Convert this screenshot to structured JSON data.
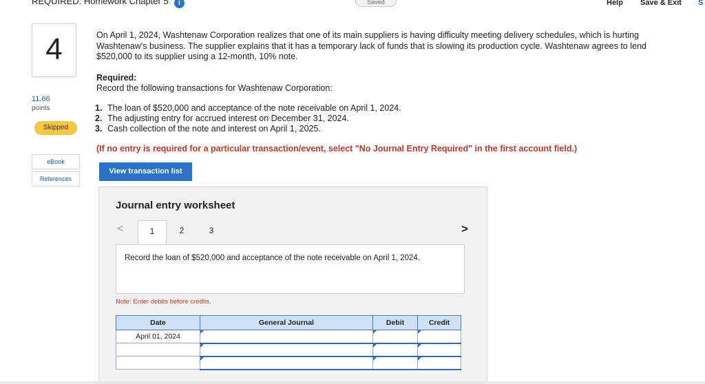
{
  "header": {
    "assignment_title": "REQUIRED: Homework Chapter 5",
    "info_badge": "i",
    "saved_status": "Saved",
    "help": "Help",
    "save_exit": "Save & Exit",
    "submit_partial": "S"
  },
  "sidebar": {
    "question_number": "4",
    "points_value": "11.66",
    "points_label": "points",
    "status_badge": "Skipped",
    "ebook": "eBook",
    "references": "References"
  },
  "question": {
    "paragraph": "On April 1, 2024, Washtenaw Corporation realizes that one of its main suppliers is having difficulty meeting delivery schedules, which is hurting Washtenaw's business. The supplier explains that it has a temporary lack of funds that is slowing its production cycle. Washtenaw agrees to lend $520,000 to its supplier using a 12-month, 10% note.",
    "required_heading": "Required:",
    "required_line": "Record the following transactions for Washtenaw Corporation:",
    "items": [
      {
        "num": "1.",
        "text": "The loan of $520,000 and acceptance of the note receivable on April 1, 2024."
      },
      {
        "num": "2.",
        "text": "The adjusting entry for accrued interest on December 31, 2024."
      },
      {
        "num": "3.",
        "text": "Cash collection of the note and interest on April 1, 2025."
      }
    ],
    "instruction": "(If no entry is required for a particular transaction/event, select \"No Journal Entry Required\" in the first account field.)",
    "view_button": "View transaction list"
  },
  "worksheet": {
    "title": "Journal entry worksheet",
    "prev_arrow": "<",
    "next_arrow": ">",
    "tabs": [
      "1",
      "2",
      "3"
    ],
    "prompt": "Record the loan of $520,000 and acceptance of the note receivable on April 1, 2024.",
    "note_label": "Note:",
    "note_text": "Enter debits before credits.",
    "columns": {
      "date": "Date",
      "journal": "General Journal",
      "debit": "Debit",
      "credit": "Credit"
    },
    "rows": [
      {
        "date": "April 01, 2024",
        "journal": "",
        "debit": "",
        "credit": ""
      },
      {
        "date": "",
        "journal": "",
        "debit": "",
        "credit": ""
      },
      {
        "date": "",
        "journal": "",
        "debit": "",
        "credit": ""
      }
    ]
  },
  "colors": {
    "accent_blue": "#2a73c9",
    "skipped_yellow": "#f7c744",
    "instruction_red": "#c0392b",
    "table_header": "#cfe0f5"
  }
}
